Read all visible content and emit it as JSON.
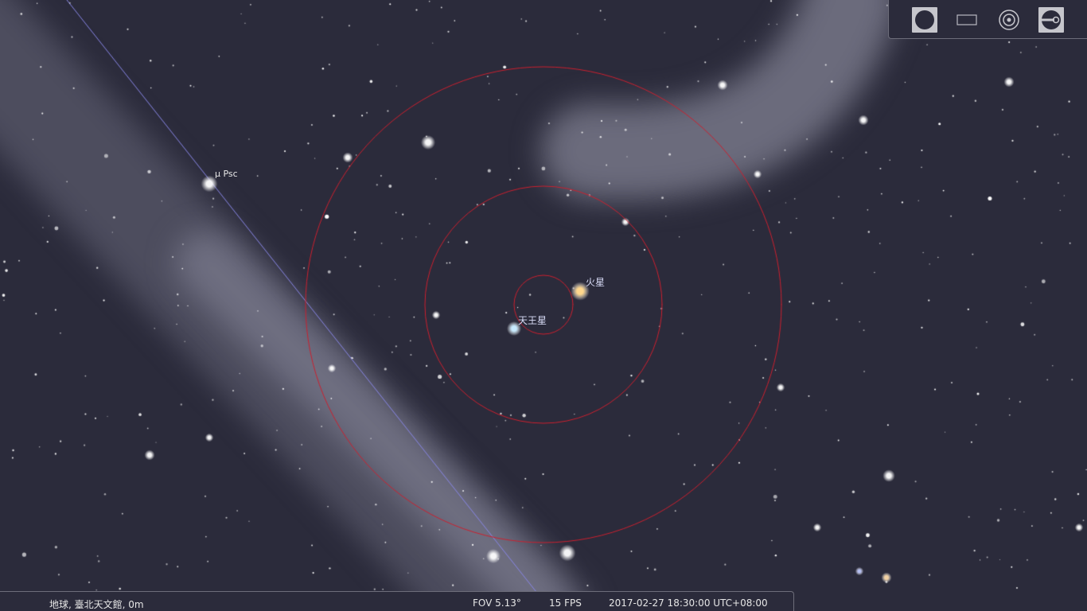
{
  "sky": {
    "background": "#2b2b3b",
    "ring_color": "#cc1f2e",
    "ecliptic_color": "#8886e6"
  },
  "labels": {
    "mars": "火星",
    "uranus": "天王星",
    "mu_psc": "μ Psc"
  },
  "toolbar": {
    "buttons": [
      {
        "icon": "ocular-icon",
        "active": true
      },
      {
        "icon": "sensor-frame-icon",
        "active": false
      },
      {
        "icon": "telrad-icon",
        "active": false
      },
      {
        "icon": "ocular-settings-icon",
        "active": true
      }
    ]
  },
  "status": {
    "location": "地球, 臺北天文館, 0m",
    "fov": "FOV 5.13°",
    "fps": "15 FPS",
    "datetime": "2017-02-27 18:30:00 UTC+08:00"
  }
}
